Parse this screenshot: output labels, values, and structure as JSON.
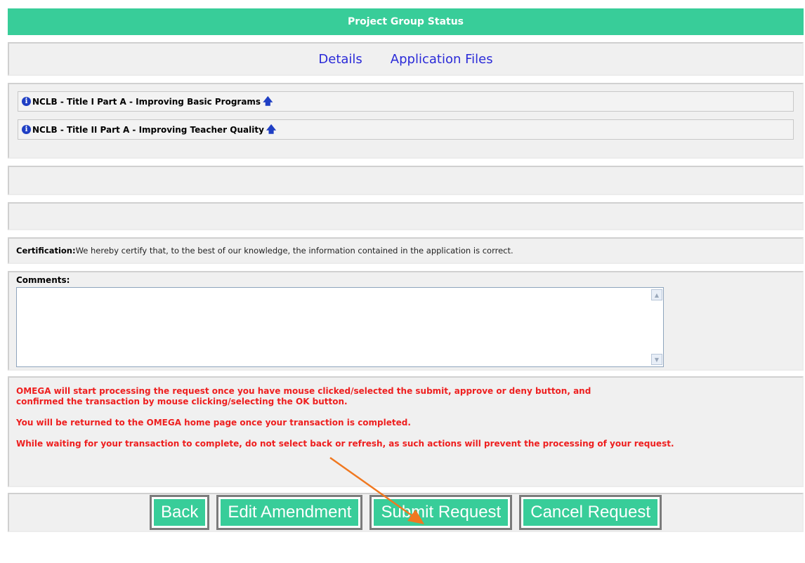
{
  "header": {
    "title": "Project Group Status"
  },
  "tabs": [
    {
      "label": "Details"
    },
    {
      "label": "Application Files"
    }
  ],
  "programs": [
    {
      "prefix": " ",
      "label": "NCLB - Title I Part A - Improving Basic Programs"
    },
    {
      "prefix": " ",
      "label": "NCLB - Title II Part A - Improving Teacher Quality"
    }
  ],
  "certification": {
    "label": "Certification:",
    "text": "We hereby certify that, to the best of our knowledge, the information contained in the application is correct."
  },
  "comments": {
    "label": "Comments:",
    "value": ""
  },
  "notice": {
    "line1": "OMEGA will start processing the request once you have mouse clicked/selected the submit, approve or deny button, and confirmed the transaction by mouse clicking/selecting the OK button.",
    "line2": "You will be returned to the OMEGA home page once your transaction is completed.",
    "line3": "While waiting for your transaction to complete, do not select back or refresh, as such actions will prevent the processing of your request."
  },
  "buttons": {
    "back": "Back",
    "edit_amendment": "Edit Amendment",
    "submit_request": "Submit Request",
    "cancel_request": "Cancel Request"
  },
  "icons": {
    "info": "info-icon",
    "up_arrow": "up-arrow-icon",
    "annotation_arrow": "arrow-annotation-icon"
  },
  "colors": {
    "header_bg": "#38cd99",
    "link": "#2a2ad8",
    "notice": "#ee1f1f",
    "annotation": "#f07820"
  }
}
